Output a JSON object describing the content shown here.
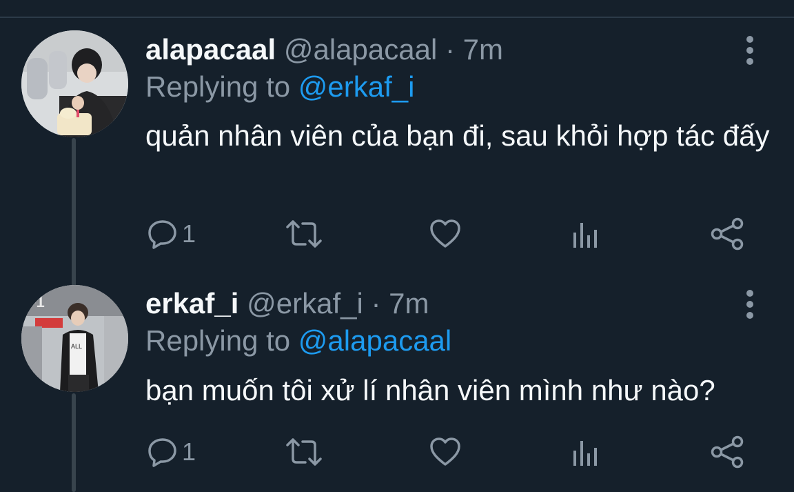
{
  "tweets": [
    {
      "display_name": "alapacaal",
      "handle": "@alapacaal",
      "separator": " · ",
      "time": "7m",
      "replying_label": "Replying to ",
      "replying_to": "@erkaf_i",
      "text": "quản nhân viên của bạn đi, sau khỏi hợp tác đấy",
      "reply_count": "1",
      "icons": [
        "more-vertical-icon",
        "reply-icon",
        "retweet-icon",
        "like-icon",
        "analytics-icon",
        "share-icon"
      ]
    },
    {
      "display_name": "erkaf_i",
      "handle": "@erkaf_i",
      "separator": " · ",
      "time": "7m",
      "replying_label": "Replying to ",
      "replying_to": "@alapacaal",
      "text": "bạn muốn tôi xử lí nhân viên mình như nào?",
      "reply_count": "1",
      "icons": [
        "more-vertical-icon",
        "reply-icon",
        "retweet-icon",
        "like-icon",
        "analytics-icon",
        "share-icon"
      ]
    }
  ],
  "colors": {
    "background": "#15202b",
    "primary_text": "#f5f8fa",
    "secondary_text": "#8b98a5",
    "accent": "#1d9bf0",
    "thread_line": "#38444d"
  }
}
